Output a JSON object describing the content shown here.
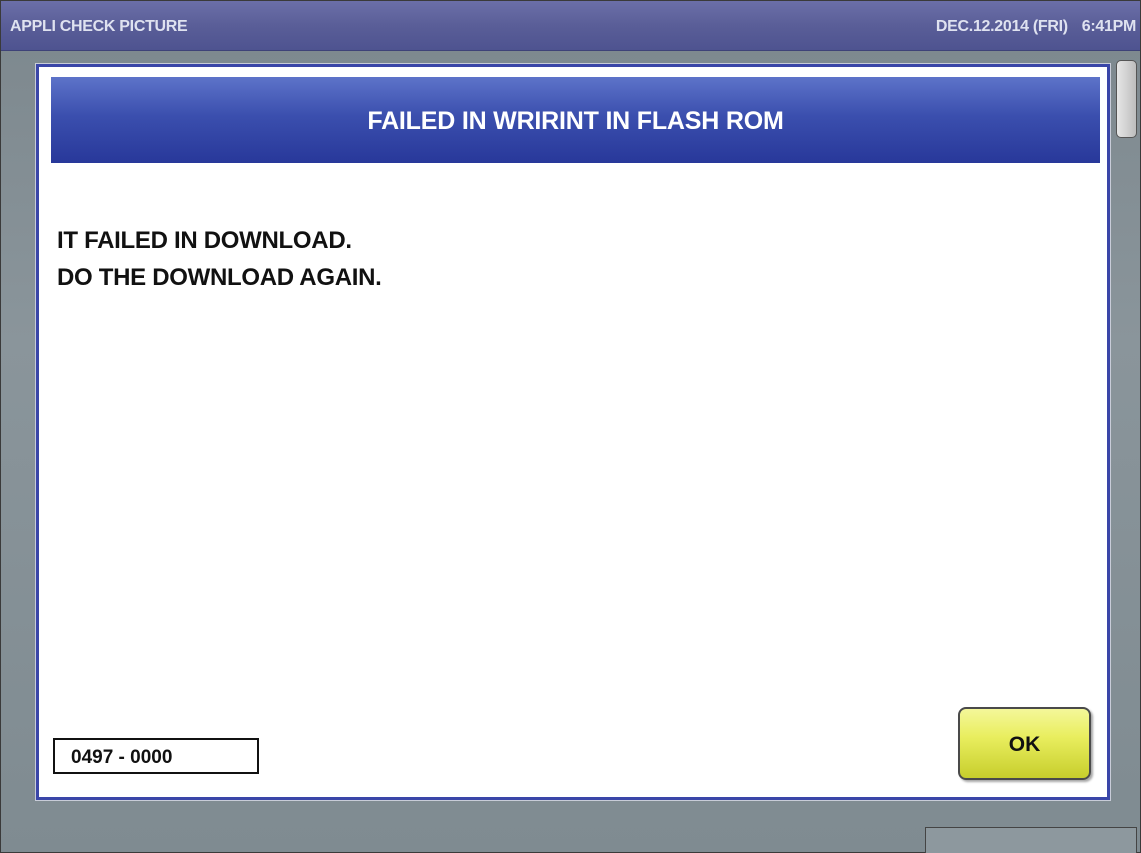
{
  "title_bar": {
    "app_title": "APPLI CHECK PICTURE",
    "date": "DEC.12.2014 (FRI)",
    "time": "6:41PM"
  },
  "dialog": {
    "title": "FAILED IN WRIRINT IN FLASH ROM",
    "message_lines": [
      "IT FAILED IN DOWNLOAD.",
      "DO THE DOWNLOAD AGAIN."
    ],
    "error_code": "0497 - 0000",
    "ok_label": "OK"
  },
  "colors": {
    "title_bar": "#5a5e98",
    "dialog_header": "#3b4fae",
    "dialog_border": "#3a46a8",
    "ok_button": "#e9ee5f",
    "background": "#84909a"
  }
}
